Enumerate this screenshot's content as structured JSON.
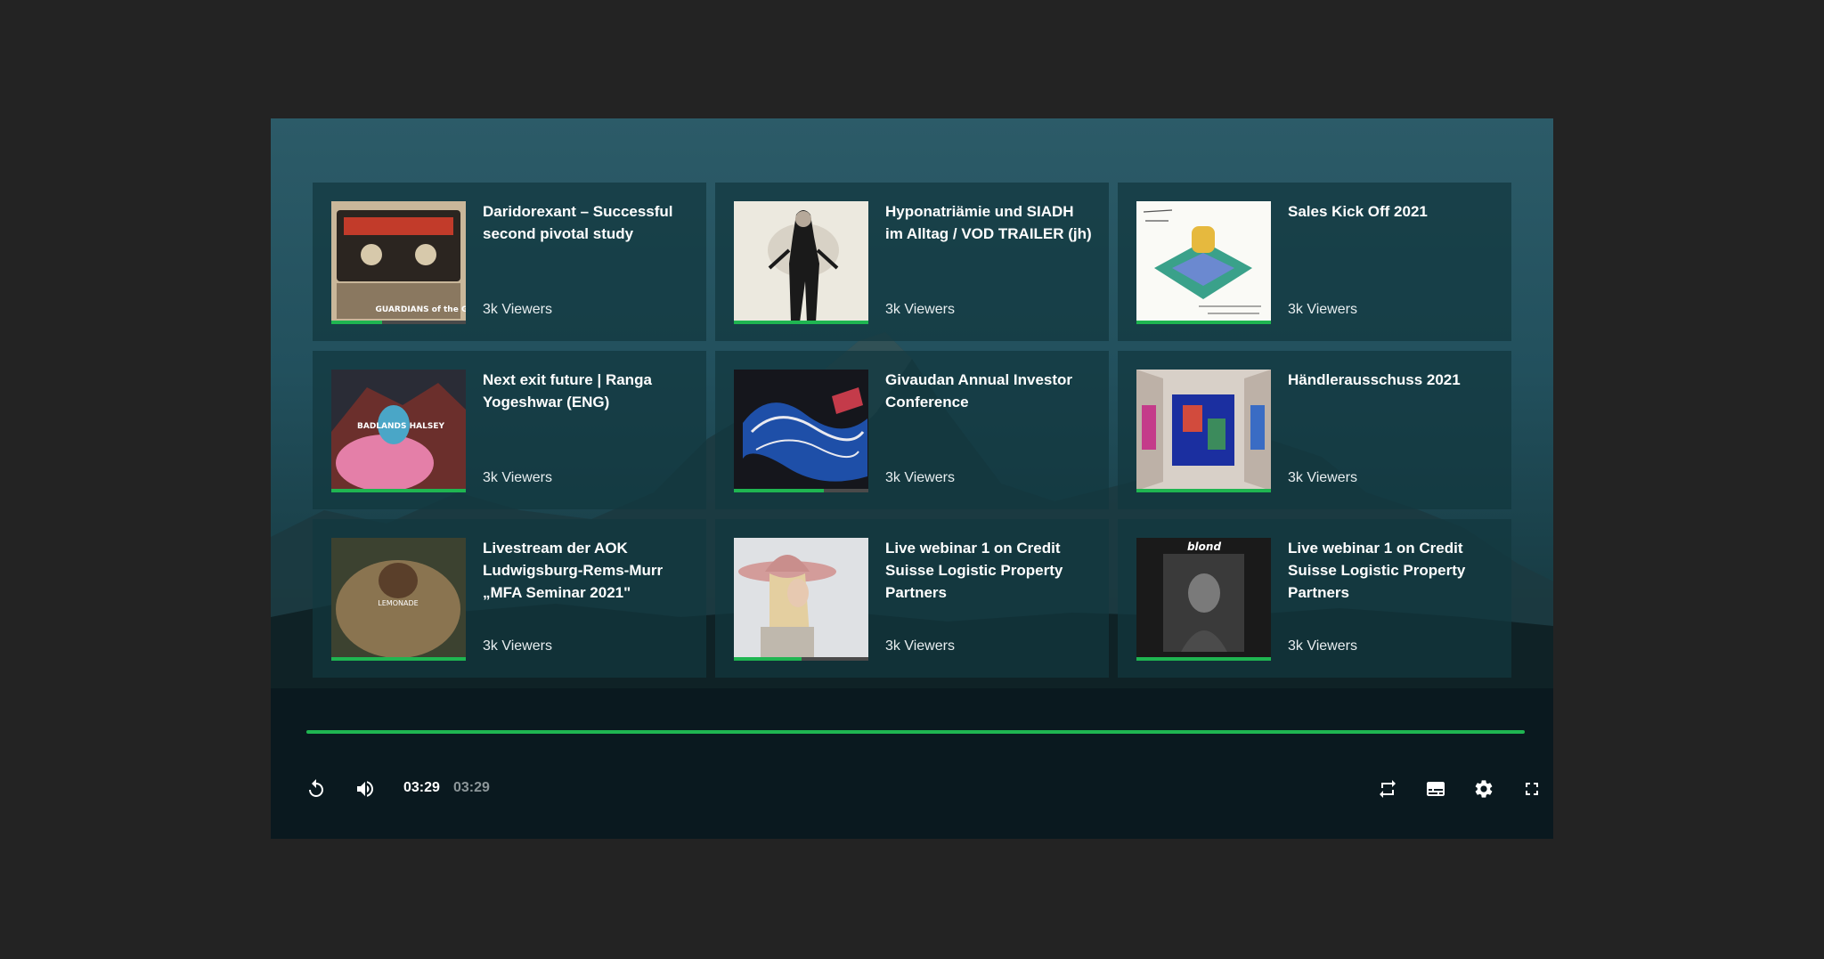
{
  "videos": [
    {
      "title": "Daridorexant – Successful second pivotal study",
      "viewers": "3k Viewers",
      "progress": 0.38
    },
    {
      "title": "Hyponatriämie und SIADH im Alltag / VOD TRAILER (jh)",
      "viewers": "3k Viewers",
      "progress": 1.0
    },
    {
      "title": "Sales Kick Off 2021",
      "viewers": "3k Viewers",
      "progress": 1.0
    },
    {
      "title": "Next exit future | Ranga Yogeshwar (ENG)",
      "viewers": "3k Viewers",
      "progress": 1.0
    },
    {
      "title": "Givaudan Annual Investor Conference",
      "viewers": "3k Viewers",
      "progress": 0.67
    },
    {
      "title": "Händlerausschuss 2021",
      "viewers": "3k Viewers",
      "progress": 1.0
    },
    {
      "title": "Livestream der AOK Ludwigsburg-Rems-Murr „MFA Seminar 2021\"",
      "viewers": "3k Viewers",
      "progress": 1.0
    },
    {
      "title": "Live webinar 1 on Credit Suisse Logistic Property Partners",
      "viewers": "3k Viewers",
      "progress": 0.5
    },
    {
      "title": "Live webinar 1 on Credit Suisse Logistic Property Partners",
      "viewers": "3k Viewers",
      "progress": 1.0
    }
  ],
  "thumb_labels": {
    "t1_text": "GUARDIANS of the GALAXY",
    "t6_text": "BADLANDS HALSEY",
    "t7_text": "LEMONADE",
    "t9_text": "blond"
  },
  "player": {
    "current_time": "03:29",
    "duration": "03:29",
    "seek_progress": 1.0
  },
  "icons": {
    "replay": "replay-icon",
    "volume": "volume-icon",
    "loop": "loop-icon",
    "subtitles": "subtitles-icon",
    "settings": "gear-icon",
    "fullscreen": "fullscreen-icon"
  },
  "colors": {
    "accent": "#1fb551",
    "page_bg": "#232323",
    "card_bg": "#12373f"
  }
}
